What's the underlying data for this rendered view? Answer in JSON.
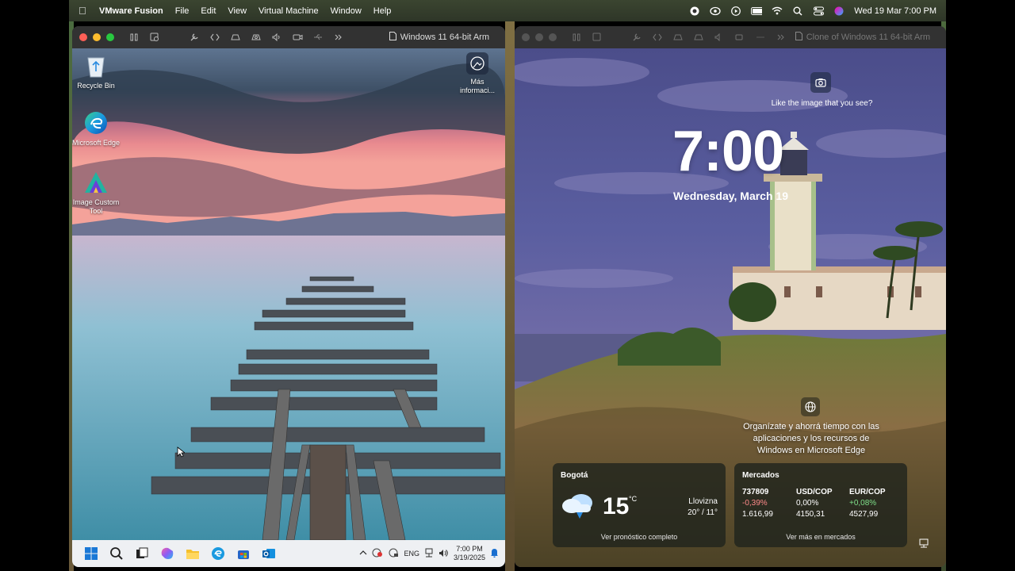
{
  "menubar": {
    "app_name": "VMware Fusion",
    "items": [
      "File",
      "Edit",
      "View",
      "Virtual Machine",
      "Window",
      "Help"
    ],
    "clock": "Wed 19 Mar  7:00 PM"
  },
  "left_window": {
    "title": "Windows 11 64-bit Arm",
    "desktop_icons": [
      "Recycle Bin",
      "Microsoft Edge",
      "Image Custom Tool"
    ],
    "info_label": "Más informaci...",
    "tray": {
      "lang": "ENG",
      "time": "7:00 PM",
      "date": "3/19/2025"
    }
  },
  "right_window": {
    "title": "Clone of Windows 11 64-bit Arm",
    "like_text": "Like the image that you see?",
    "time": "7:00",
    "date": "Wednesday, March 19",
    "edge_tip": "Organízate y ahorrá tiempo con las aplicaciones y los recursos de Windows en Microsoft Edge",
    "weather": {
      "city": "Bogotá",
      "temp": "15",
      "unit": "°C",
      "condition": "Llovizna",
      "range": "20° / 11°",
      "link": "Ver pronóstico completo"
    },
    "markets": {
      "title": "Mercados",
      "tickers": [
        {
          "symbol": "737809",
          "change": "-0,39%",
          "value": "1.616,99"
        },
        {
          "symbol": "USD/COP",
          "change": "0,00%",
          "value": "4150,31"
        },
        {
          "symbol": "EUR/COP",
          "change": "+0,08%",
          "value": "4527,99"
        }
      ],
      "link": "Ver más en mercados"
    }
  }
}
